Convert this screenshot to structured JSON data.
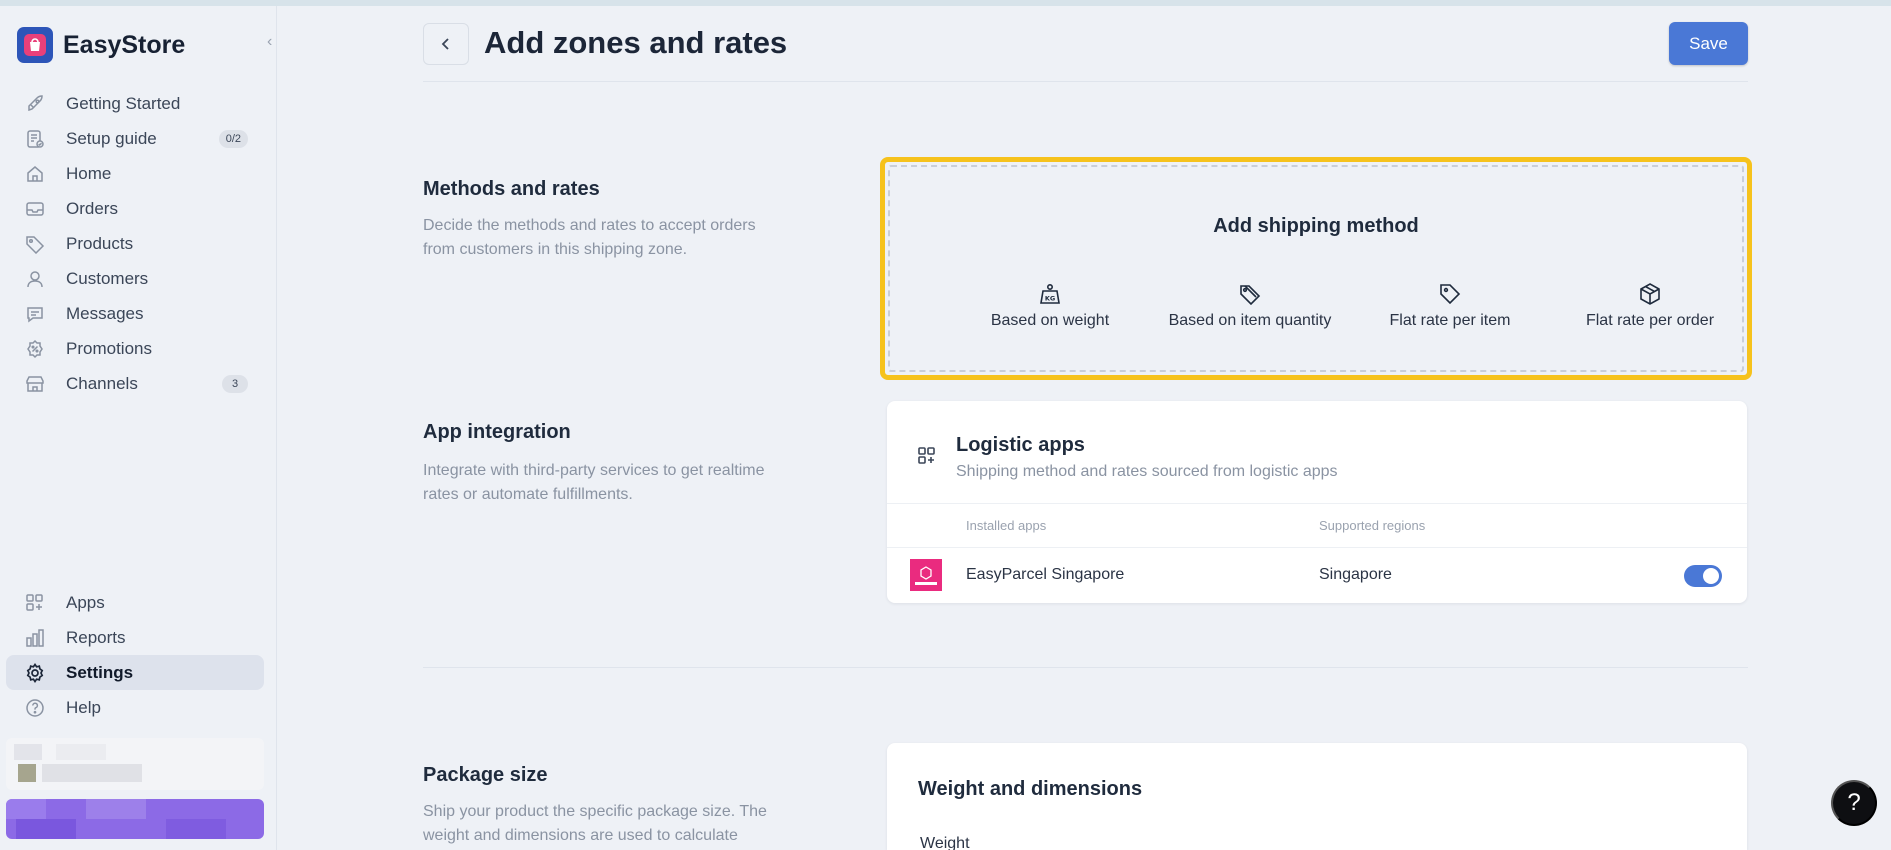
{
  "app": {
    "name": "EasyStore"
  },
  "sidebar": {
    "items": [
      {
        "label": "Getting Started",
        "icon": "rocket-icon"
      },
      {
        "label": "Setup guide",
        "icon": "checklist-icon",
        "badge": "0/2"
      },
      {
        "label": "Home",
        "icon": "home-icon"
      },
      {
        "label": "Orders",
        "icon": "inbox-icon"
      },
      {
        "label": "Products",
        "icon": "tag-icon"
      },
      {
        "label": "Customers",
        "icon": "user-icon"
      },
      {
        "label": "Messages",
        "icon": "chat-icon"
      },
      {
        "label": "Promotions",
        "icon": "discount-icon"
      },
      {
        "label": "Channels",
        "icon": "store-icon",
        "badge": "3"
      }
    ],
    "bottom_items": [
      {
        "label": "Apps",
        "icon": "apps-icon"
      },
      {
        "label": "Reports",
        "icon": "bar-chart-icon"
      },
      {
        "label": "Settings",
        "icon": "gear-icon",
        "active": true
      },
      {
        "label": "Help",
        "icon": "question-circle-icon"
      }
    ]
  },
  "header": {
    "title": "Add zones and rates",
    "save_label": "Save"
  },
  "methods": {
    "title": "Methods and rates",
    "description": "Decide the methods and rates to accept orders from customers in this shipping zone.",
    "box_title": "Add shipping method",
    "options": [
      {
        "label": "Based on weight",
        "icon": "weight-kg-icon"
      },
      {
        "label": "Based on item quantity",
        "icon": "tags-icon"
      },
      {
        "label": "Flat rate per item",
        "icon": "price-tag-icon"
      },
      {
        "label": "Flat rate per order",
        "icon": "package-box-icon"
      }
    ]
  },
  "app_integration": {
    "title": "App integration",
    "description": "Integrate with third-party services to get realtime rates or automate fulfillments.",
    "card_title": "Logistic apps",
    "card_subtitle": "Shipping method and rates sourced from logistic apps",
    "columns": [
      "Installed apps",
      "Supported regions"
    ],
    "rows": [
      {
        "app": "EasyParcel Singapore",
        "region": "Singapore",
        "enabled": true
      }
    ]
  },
  "package": {
    "title": "Package size",
    "description": "Ship your product the specific package size. The weight and dimensions are used to calculate",
    "card_title": "Weight and dimensions",
    "weight_label": "Weight"
  },
  "help_fab": "?",
  "colors": {
    "primary": "#4a78d6",
    "highlight": "#f6c21c",
    "brand": "#2d55b8"
  }
}
